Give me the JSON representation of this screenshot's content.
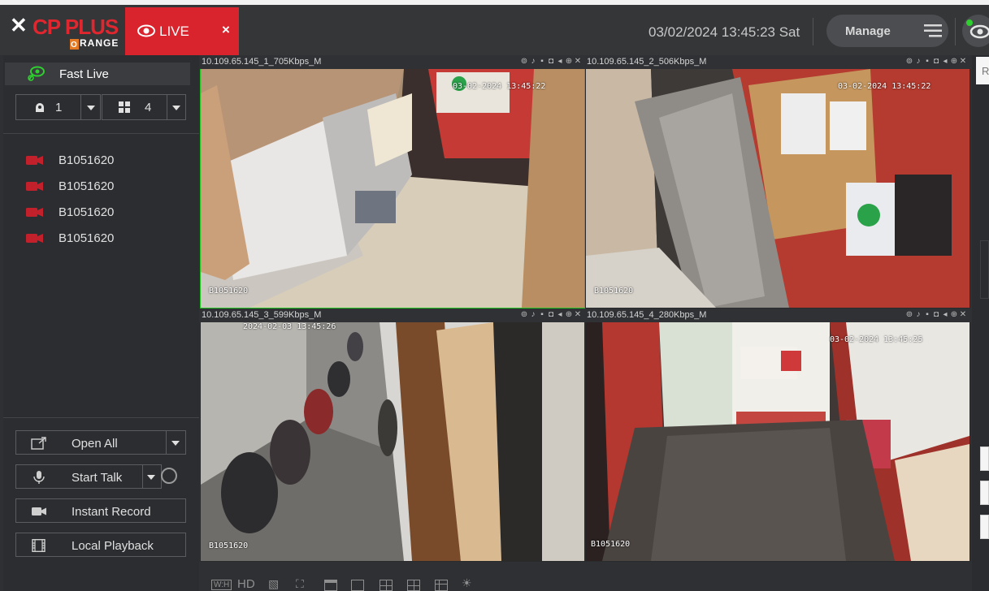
{
  "app": {
    "logo_main": "CP PLUS",
    "logo_sub": "RANGE",
    "logo_sub_initial": "O"
  },
  "header": {
    "live_tab_label": "LIVE",
    "live_tab_close": "×",
    "datetime": "03/02/2024 13:45:23 Sat",
    "manage_label": "Manage"
  },
  "sidebar": {
    "fast_live_label": "Fast Live",
    "stream_selector": "1",
    "layout_selector": "4",
    "devices": [
      {
        "label": "B1051620"
      },
      {
        "label": "B1051620"
      },
      {
        "label": "B1051620"
      },
      {
        "label": "B1051620"
      }
    ],
    "actions": {
      "open_all": "Open All",
      "start_talk": "Start Talk",
      "instant_record": "Instant Record",
      "local_playback": "Local Playback"
    }
  },
  "channels": [
    {
      "title": "10.109.65.145_1_705Kbps_M",
      "osd_name": "B1051620",
      "osd_time": "03-02-2024 13:45:22"
    },
    {
      "title": "10.109.65.145_2_506Kbps_M",
      "osd_name": "B1051620",
      "osd_time": "03-02-2024 13:45:22"
    },
    {
      "title": "10.109.65.145_3_599Kbps_M",
      "osd_name": "B1051620",
      "osd_time": "2024-02-03 13:45:26"
    },
    {
      "title": "10.109.65.145_4_280Kbps_M",
      "osd_name": "B1051620",
      "osd_time": "03-02-2024 13:45:25"
    }
  ],
  "bottom_toolbar": {
    "aspect_label": "W:H",
    "quality_label": "HD"
  },
  "right_panel": {
    "tab_letter": "R"
  },
  "colors": {
    "accent_red": "#d9232d",
    "selected_border": "#1ec51e",
    "background": "#2e3033"
  }
}
